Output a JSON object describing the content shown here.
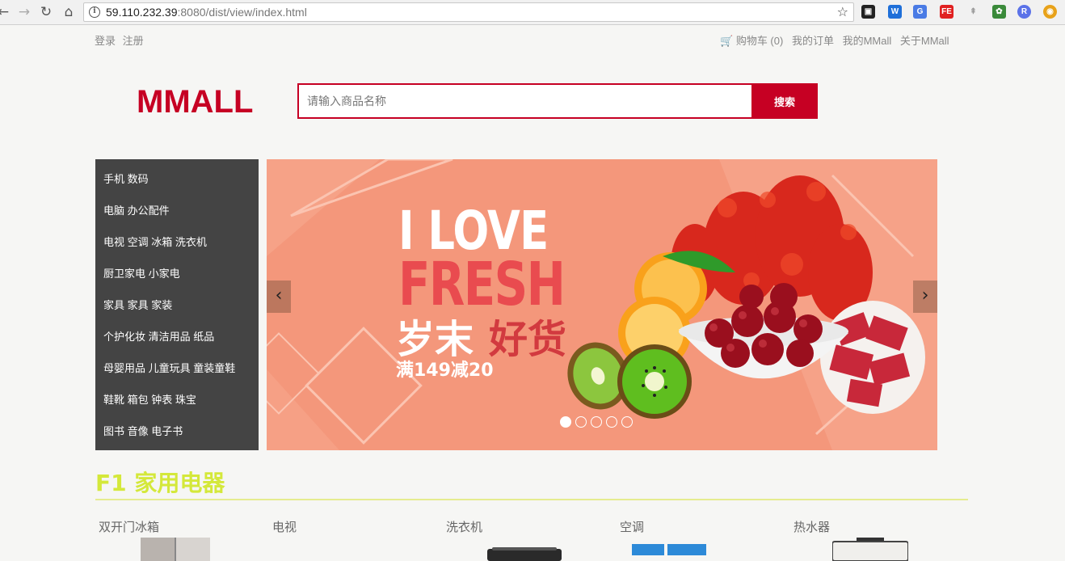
{
  "browser": {
    "url_host": "59.110.232.39",
    "url_rest": ":8080/dist/view/index.html"
  },
  "top_left_links": [
    "登录",
    "注册"
  ],
  "top_right_links": [
    "购物车 (0)",
    "我的订单",
    "我的MMall",
    "关于MMall"
  ],
  "logo": "MMALL",
  "search": {
    "placeholder": "请输入商品名称",
    "button": "搜索"
  },
  "categories": [
    "手机 数码",
    "电脑 办公配件",
    "电视 空调 冰箱 洗衣机",
    "厨卫家电 小家电",
    "家具 家具 家装",
    "个护化妆 清洁用品 纸品",
    "母婴用品 儿童玩具 童装童鞋",
    "鞋靴 箱包 钟表 珠宝",
    "图书 音像 电子书"
  ],
  "banner": {
    "line1": "I LOVE",
    "line2": "FRESH",
    "line3a": "岁末",
    "line3b": "好货",
    "promo": "满149减20",
    "slide_count": 5,
    "active_slide": 1
  },
  "floor": {
    "title": "F1 家用电器",
    "categories": [
      "双开门冰箱",
      "电视",
      "洗衣机",
      "空调",
      "热水器"
    ]
  },
  "colors": {
    "brand": "#c60023",
    "menu_bg": "#444444",
    "banner_bg": "#f4977b",
    "floor_title": "#d4e83a"
  }
}
